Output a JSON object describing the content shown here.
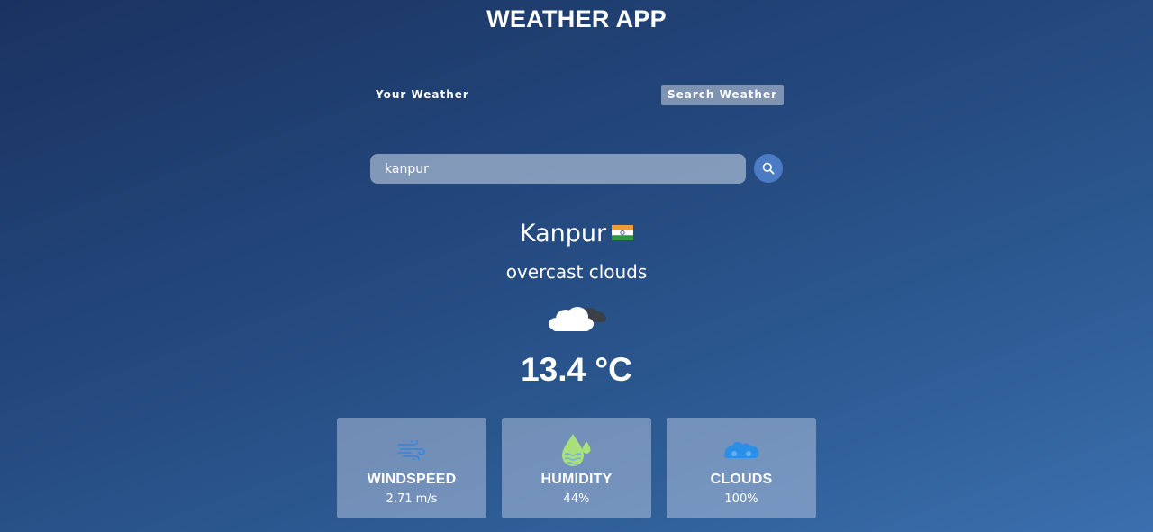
{
  "header": {
    "title": "WEATHER APP"
  },
  "tabs": [
    {
      "label": "Your Weather",
      "active": false
    },
    {
      "label": "Search Weather",
      "active": true
    }
  ],
  "search": {
    "value": "kanpur",
    "button_icon": "search-icon"
  },
  "weather": {
    "city": "Kanpur",
    "country_flag": "india-flag-icon",
    "description": "overcast clouds",
    "icon": "overcast-clouds-icon",
    "temperature": "13.4 °C"
  },
  "stats": [
    {
      "title": "WINDSPEED",
      "value": "2.71 m/s",
      "icon": "wind-icon"
    },
    {
      "title": "HUMIDITY",
      "value": "44%",
      "icon": "humidity-icon"
    },
    {
      "title": "CLOUDS",
      "value": "100%",
      "icon": "clouds-icon"
    }
  ],
  "colors": {
    "accent": "#4a7bc4",
    "humidity_icon": "#a9e07a",
    "cloud_icon": "#2b8fe6",
    "wind_icon": "#3d86d9"
  }
}
